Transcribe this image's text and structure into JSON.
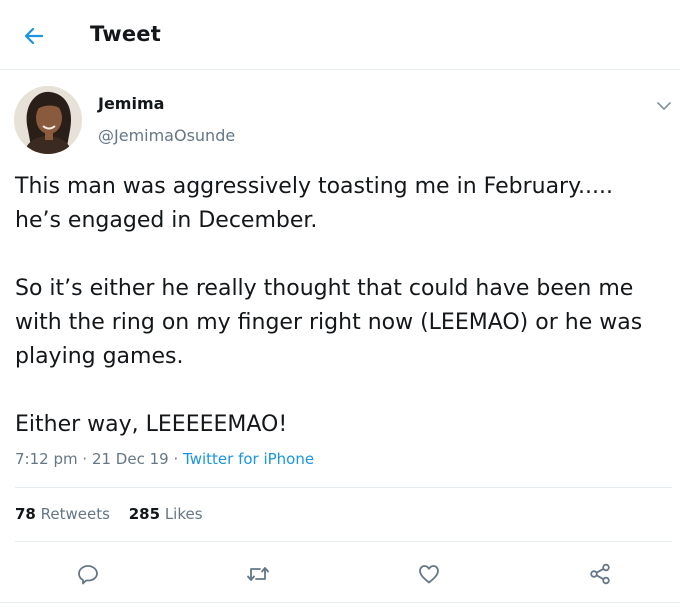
{
  "header": {
    "title": "Tweet",
    "back_icon": "arrow-left-icon"
  },
  "tweet": {
    "author_name": "Jemima",
    "author_handle": "@JemimaOsunde",
    "paragraphs": [
      "This man was aggressively toasting me in February..... he’s engaged in December.",
      "So it’s either he really thought that could have been me with the ring on my finger right now (LEEMAO) or he was playing games.",
      "Either way, LEEEEEMAO!"
    ],
    "time": "7:12 pm",
    "separator": "·",
    "date": "21 Dec 19",
    "source": "Twitter for iPhone",
    "retweets_count": "78",
    "retweets_label": "Retweets",
    "likes_count": "285",
    "likes_label": "Likes"
  },
  "actions": [
    {
      "name": "reply",
      "icon": "reply-icon"
    },
    {
      "name": "retweet",
      "icon": "retweet-icon"
    },
    {
      "name": "like",
      "icon": "heart-icon"
    },
    {
      "name": "share",
      "icon": "share-icon"
    }
  ],
  "colors": {
    "accent": "#1b95e0",
    "text": "#14171a",
    "secondary": "#657786",
    "border": "#e6ecf0"
  }
}
